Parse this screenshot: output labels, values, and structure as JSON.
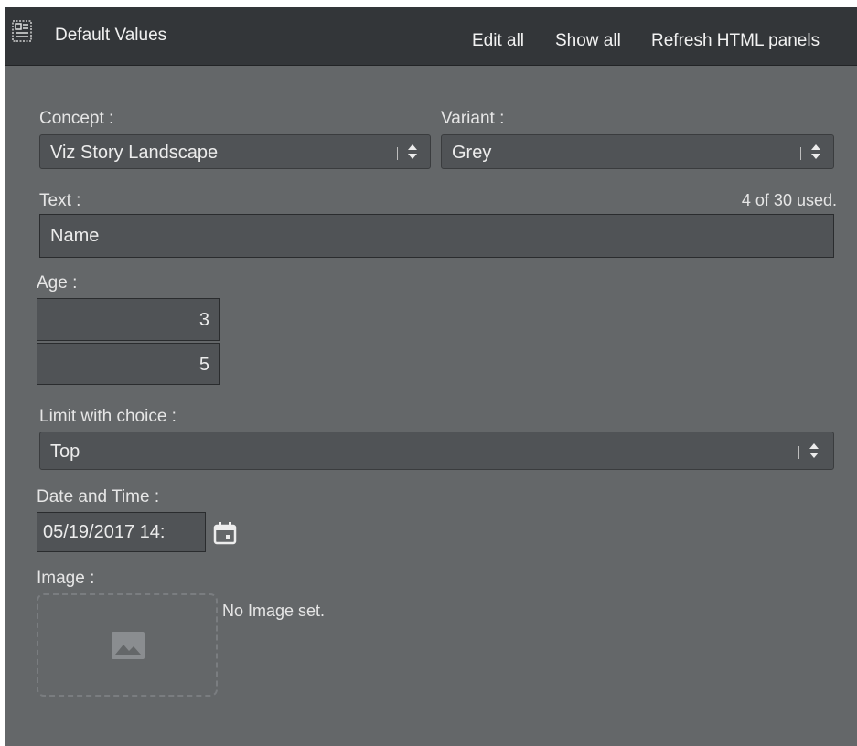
{
  "header": {
    "title": "Default Values",
    "icon": "template-icon",
    "actions": [
      "Edit all",
      "Show all",
      "Refresh HTML panels"
    ]
  },
  "form": {
    "concept": {
      "label": "Concept :",
      "value": "Viz Story Landscape"
    },
    "variant": {
      "label": "Variant :",
      "value": "Grey"
    },
    "text": {
      "label": "Text :",
      "counter": "4 of 30 used.",
      "value": "Name"
    },
    "age": {
      "label": "Age :",
      "values": [
        "3",
        "5"
      ]
    },
    "limit": {
      "label": "Limit with choice :",
      "value": "Top"
    },
    "datetime": {
      "label": "Date and Time :",
      "value": "05/19/2017 14:",
      "icon": "calendar-icon"
    },
    "image": {
      "label": "Image :",
      "status": "No Image set.",
      "icon": "image-placeholder-icon"
    }
  },
  "colors": {
    "header_bg": "#333639",
    "panel_bg": "#646769",
    "field_bg": "#505356"
  }
}
